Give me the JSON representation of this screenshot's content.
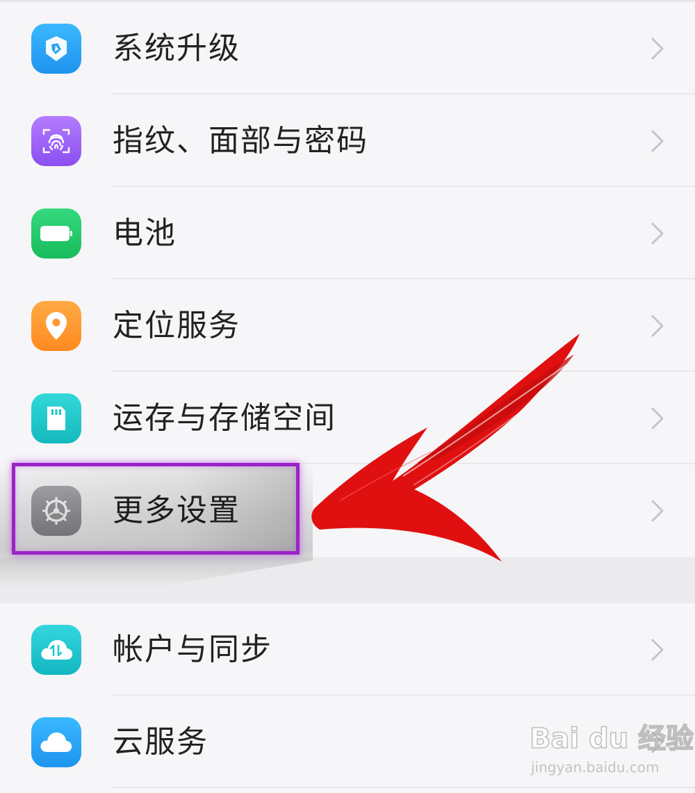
{
  "settings": {
    "group_main": [
      {
        "label": "系统升级",
        "icon": "system-update-icon",
        "color": "#2aa8f5"
      },
      {
        "label": "指纹、面部与密码",
        "icon": "fingerprint-icon",
        "color": "#9b5cf0"
      },
      {
        "label": "电池",
        "icon": "battery-icon",
        "color": "#22c96a"
      },
      {
        "label": "定位服务",
        "icon": "location-pin-icon",
        "color": "#ff9630"
      },
      {
        "label": "运存与存储空间",
        "icon": "sd-card-icon",
        "color": "#1fc7c9"
      },
      {
        "label": "更多设置",
        "icon": "gear-icon",
        "color": "#9a9a9e"
      }
    ],
    "group_account": [
      {
        "label": "帐户与同步",
        "icon": "cloud-sync-icon",
        "color": "#1ec8d0"
      },
      {
        "label": "云服务",
        "icon": "cloud-icon",
        "color": "#2aa8f5"
      }
    ]
  },
  "annotation": {
    "highlight_color": "#9b22c8",
    "arrow_color": "#e01010"
  },
  "watermark": {
    "logo": "Bai du 经验",
    "url": "jingyan.baidu.com"
  }
}
